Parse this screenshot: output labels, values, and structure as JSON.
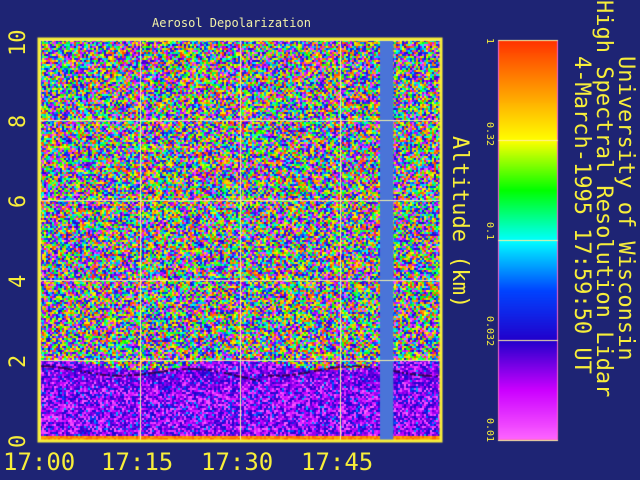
{
  "chart_data": {
    "type": "heatmap",
    "title": "Aerosol Depolarization",
    "ylabel": "Altitude (km)",
    "xlabel": "",
    "x_ticks": [
      "17:00",
      "17:15",
      "17:30",
      "17:45"
    ],
    "y_ticks": [
      "0",
      "2",
      "4",
      "6",
      "8",
      "10"
    ],
    "ylim": [
      0,
      10
    ],
    "x_range": [
      "17:00",
      "18:00"
    ],
    "grid": true,
    "colorbar": {
      "scale": "log",
      "range": [
        0.01,
        1
      ],
      "tick_labels": [
        "1",
        "0.32",
        "0.1",
        "0.032",
        "0.01"
      ],
      "colors": [
        "#ff3300",
        "#ff9900",
        "#ffff00",
        "#00ff00",
        "#00ffff",
        "#0044ff",
        "#2200cc",
        "#cc00ff",
        "#ff66ff"
      ]
    },
    "features": {
      "boundary_layer_top_km": 2.0,
      "data_gap": [
        "17:51",
        "17:53"
      ]
    }
  },
  "info": {
    "line1": "University of Wisconsin",
    "line2": "High Spectral Resolution Lidar",
    "line3": "4-March-1995 17:59:50 UT"
  },
  "colors": {
    "background": "#1e2474",
    "axes": "#f7ee3a",
    "grid": "#f2f2a8",
    "gap": "#4a74d8"
  }
}
